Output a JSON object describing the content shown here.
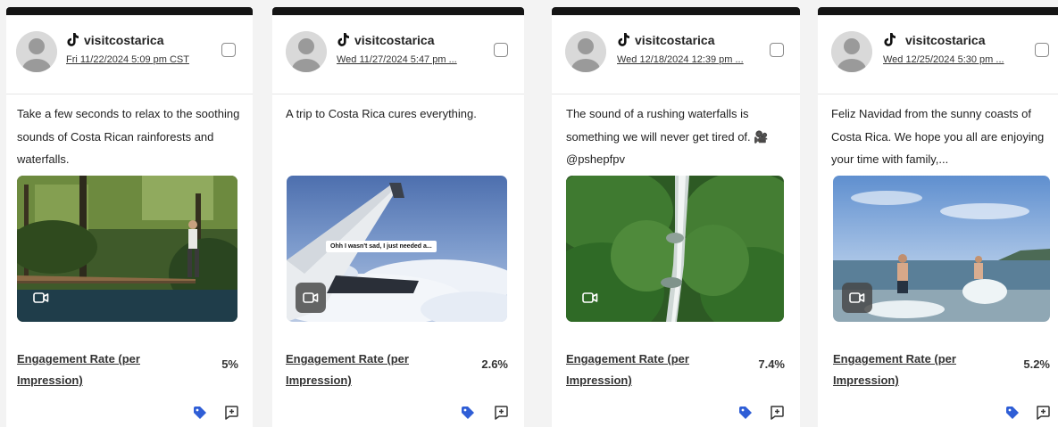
{
  "colors": {
    "topbar": "#141414",
    "tag_blue": "#2f5ed6",
    "card_bg": "#ffffff",
    "page_bg": "#f3f3f3"
  },
  "posts": [
    {
      "platform_icon": "tiktok-icon",
      "username": "visitcostarica",
      "date": "Fri 11/22/2024 5:09 pm CST",
      "caption": "Take a few seconds to relax to the soothing sounds of Costa Rican rainforests and waterfalls.",
      "media_type": "video",
      "media_scene": "jungle-bridge",
      "metric_label": "Engagement Rate (per Impression)",
      "metric_value": "5%"
    },
    {
      "platform_icon": "tiktok-icon",
      "username": "visitcostarica",
      "date": "Wed 11/27/2024 5:47 pm ...",
      "caption": "A trip to Costa Rica cures everything.",
      "media_type": "video",
      "media_scene": "airplane-wing",
      "media_overlay_text": "Ohh I wasn't sad, I just needed a...",
      "metric_label": "Engagement Rate (per Impression)",
      "metric_value": "2.6%"
    },
    {
      "platform_icon": "tiktok-icon",
      "username": "visitcostarica",
      "date": "Wed 12/18/2024 12:39 pm ...",
      "caption": "The sound of a rushing waterfalls is something we will never get tired of. 🎥 @pshepfpv",
      "media_type": "video",
      "media_scene": "waterfall",
      "metric_label": "Engagement Rate (per Impression)",
      "metric_value": "7.4%"
    },
    {
      "platform_icon": "tiktok-icon",
      "username": "visitcostarica",
      "date": "Wed 12/25/2024 5:30 pm ...",
      "caption": "Feliz Navidad from the sunny coasts of Costa Rica. We hope you all are enjoying your time with family,...",
      "media_type": "video",
      "media_scene": "beach",
      "metric_label": "Engagement Rate (per Impression)",
      "metric_value": "5.2%"
    }
  ]
}
